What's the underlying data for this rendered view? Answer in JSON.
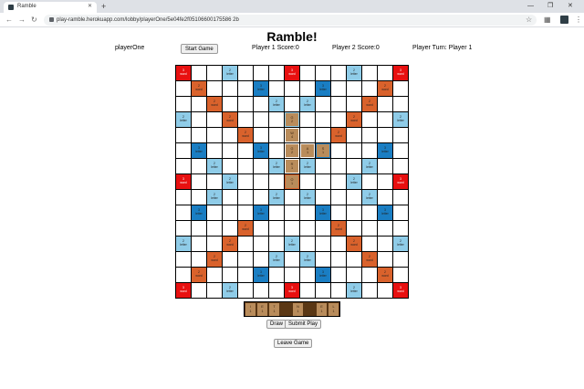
{
  "browser": {
    "tab_title": "Ramble",
    "url": "play-ramble.herokuapp.com/lobby/playerOne/5e04fe2f05106600175586 2b"
  },
  "page": {
    "title": "Ramble!",
    "player_name": "playerOne",
    "start_button": "Start Game",
    "p1_score": "Player 1 Score:0",
    "p2_score": "Player 2 Score:0",
    "turn": "Player Turn: Player 1",
    "draw_button": "Draw",
    "submit_button": "Submit Play",
    "leave_button": "Leave Game"
  },
  "board": {
    "size": 15,
    "labels": {
      "t3w": [
        "3",
        "word"
      ],
      "t2w": [
        "2",
        "word"
      ],
      "t2l": [
        "2",
        "letter"
      ],
      "t3l": [
        "3",
        "letter"
      ]
    },
    "premium_rows": [
      "W..l...W...l..W",
      ".w...L...L...w.",
      "..w...l.l...w..",
      "l..w...l...w..l",
      "....w.....w....",
      ".L...L...L...L.",
      "..l...l.l...l..",
      "W..l...w...l..W",
      "..l...l.l...l..",
      ".L...L...L...L.",
      "....w.....w....",
      "l..w...l...w..l",
      "..w...l.l...w..",
      ".w...L...L...w.",
      "W..l...W...l..W"
    ],
    "placed_tiles": [
      {
        "row": 3,
        "col": 7,
        "letter": "G",
        "points": "2"
      },
      {
        "row": 4,
        "col": 7,
        "letter": "W",
        "points": "4"
      },
      {
        "row": 5,
        "col": 7,
        "letter": "G",
        "points": "2"
      },
      {
        "row": 5,
        "col": 8,
        "letter": "A",
        "points": "1"
      },
      {
        "row": 5,
        "col": 9,
        "letter": "S",
        "points": "1"
      },
      {
        "row": 6,
        "col": 7,
        "letter": "R",
        "points": "1"
      },
      {
        "row": 7,
        "col": 7,
        "letter": "O",
        "points": "1"
      }
    ]
  },
  "rack": [
    {
      "letter": "I",
      "points": "1"
    },
    {
      "letter": "E",
      "points": "1"
    },
    {
      "letter": "T",
      "points": "1"
    },
    null,
    {
      "letter": "N",
      "points": "1"
    },
    null,
    {
      "letter": "E",
      "points": "1"
    },
    {
      "letter": "L",
      "points": "1"
    }
  ]
}
